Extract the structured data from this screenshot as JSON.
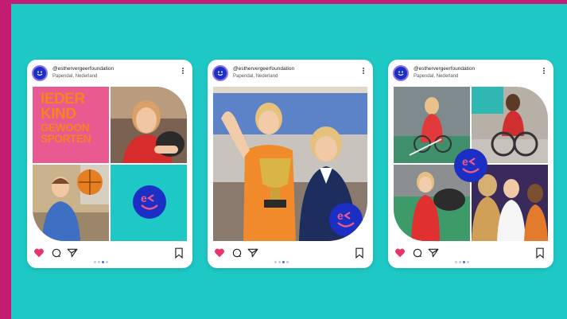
{
  "posts": [
    {
      "handle": "@esthervergeerfoundation",
      "location": "Papendal, Nederland",
      "poster_lines": [
        "IEDER",
        "KIND",
        "GEWOON",
        "SPORTEN"
      ]
    },
    {
      "handle": "@esthervergeerfoundation",
      "location": "Papendal, Nederland"
    },
    {
      "handle": "@esthervergeerfoundation",
      "location": "Papendal, Nederland"
    }
  ],
  "icons": {
    "like": "heart-icon",
    "comment": "comment-icon",
    "share": "send-icon",
    "save": "bookmark-icon",
    "avatar": "smiley-logo-icon",
    "more": "more-options-icon"
  },
  "colors": {
    "background_border": "#c21d73",
    "background": "#1ec8c5",
    "brand_blue": "#1c2fc4",
    "poster_pink": "#e95a91",
    "poster_orange": "#f4841f",
    "like_red": "#e8336b"
  },
  "carousel": {
    "slides": 4,
    "active_slide": 3
  }
}
